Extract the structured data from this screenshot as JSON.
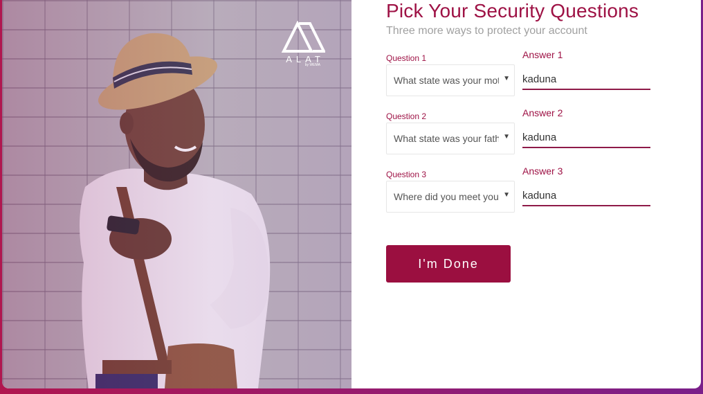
{
  "brand": {
    "name": "ALAT",
    "sub": "by WEMA"
  },
  "header": {
    "title": "Pick Your Security Questions",
    "subtitle": "Three more ways to protect your account"
  },
  "questions": [
    {
      "label": "Question 1",
      "selected": "What state was your mother born in?",
      "answer_label": "Answer 1",
      "answer": "kaduna"
    },
    {
      "label": "Question 2",
      "selected": "What state was your father born in?",
      "answer_label": "Answer 2",
      "answer": "kaduna"
    },
    {
      "label": "Question 3",
      "selected": "Where did you meet your spouse?",
      "answer_label": "Answer 3",
      "answer": "kaduna"
    }
  ],
  "actions": {
    "done_label": "I'm Done"
  },
  "colors": {
    "accent": "#9e1245",
    "button": "#9b0f40",
    "gradient_start": "#b0164f",
    "gradient_end": "#7a1f8a"
  }
}
